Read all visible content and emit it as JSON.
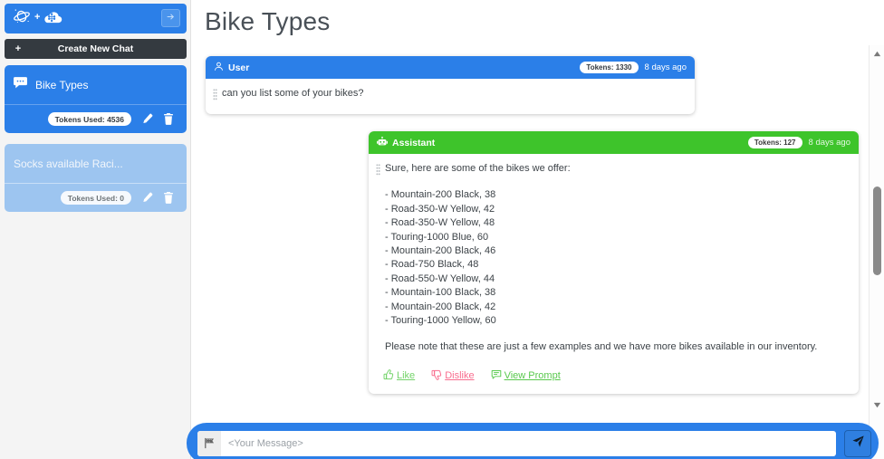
{
  "sidebar": {
    "logo": {
      "galaxy_icon": "galaxy-icon",
      "plus": "+",
      "cloud_brain_icon": "cloud-brain-icon"
    },
    "collapse_button": {
      "icon": "arrow-right-icon"
    },
    "new_chat_button": {
      "plus": "+",
      "label": "Create New Chat"
    },
    "chats": [
      {
        "title": "Bike Types",
        "icon": "chat-bubble-icon",
        "tokens_label": "Tokens Used: 4536",
        "edit_icon": "pencil-icon",
        "delete_icon": "trash-icon",
        "active": true
      },
      {
        "title": "Socks available Raci...",
        "icon": "",
        "tokens_label": "Tokens Used: 0",
        "edit_icon": "pencil-icon",
        "delete_icon": "trash-icon",
        "active": false
      }
    ]
  },
  "main": {
    "title": "Bike Types",
    "messages": [
      {
        "role": "User",
        "role_icon": "user-icon",
        "tokens": "Tokens: 1330",
        "time": "8 days ago",
        "text": "can you list some of your bikes?"
      },
      {
        "role": "Assistant",
        "role_icon": "robot-icon",
        "tokens": "Tokens: 127",
        "time": "8 days ago",
        "text": "Sure, here are some of the bikes we offer:",
        "bikes": [
          "- Mountain-200 Black, 38",
          "- Road-350-W Yellow, 42",
          "- Road-350-W Yellow, 48",
          "- Touring-1000 Blue, 60",
          "- Mountain-200 Black, 46",
          "- Road-750 Black, 48",
          "- Road-550-W Yellow, 44",
          "- Mountain-100 Black, 38",
          "- Mountain-200 Black, 42",
          "- Touring-1000 Yellow, 60"
        ],
        "closing": "Please note that these are just a few examples and we have more bikes available in our inventory.",
        "actions": [
          {
            "label": "Like",
            "icon": "thumbs-up-icon",
            "color": "#74d36a"
          },
          {
            "label": "Dislike",
            "icon": "thumbs-down-icon",
            "color": "#f86d8e"
          },
          {
            "label": "View Prompt",
            "icon": "comment-icon",
            "color": "#59c94d"
          }
        ]
      }
    ]
  },
  "composer": {
    "left_icon": "flag-icon",
    "placeholder": "<Your Message>",
    "value": "",
    "send_icon": "send-icon"
  },
  "scrollbar": {
    "up_icon": "scroll-up-arrow-icon",
    "down_icon": "scroll-down-arrow-icon"
  },
  "colors": {
    "accent_blue": "#2b7fe8",
    "assistant_green": "#3ec42b",
    "dark_button": "#343a40",
    "inactive_blue": "#9dc5f0"
  }
}
